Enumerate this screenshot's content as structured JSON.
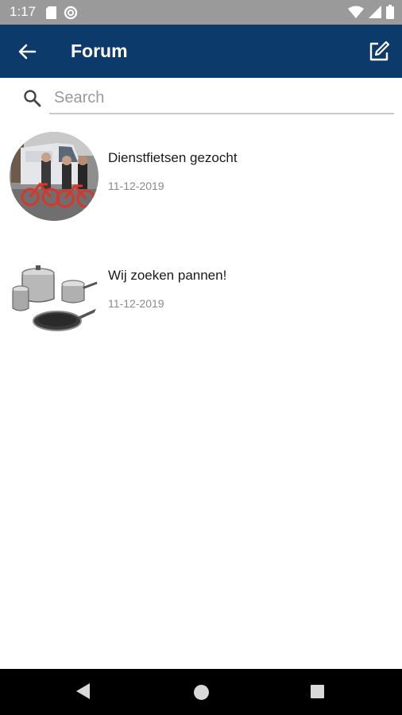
{
  "status_bar": {
    "time": "1:17",
    "left_icons": [
      "sd-card-icon",
      "data-saver-icon"
    ],
    "right_icons": [
      "wifi-icon",
      "cellular-signal-icon",
      "battery-icon"
    ]
  },
  "app_bar": {
    "title": "Forum",
    "back_icon": "arrow-left-icon",
    "compose_icon": "compose-icon",
    "color": "#0c3a6a"
  },
  "search": {
    "placeholder": "Search",
    "value": ""
  },
  "posts": [
    {
      "title": "Dienstfietsen gezocht",
      "date": "11-12-2019",
      "thumbnail": "bikes-photo"
    },
    {
      "title": "Wij zoeken pannen!",
      "date": "11-12-2019",
      "thumbnail": "cookware-photo"
    }
  ],
  "nav_bar": {
    "icons": [
      "nav-back-icon",
      "nav-home-icon",
      "nav-recents-icon"
    ]
  }
}
